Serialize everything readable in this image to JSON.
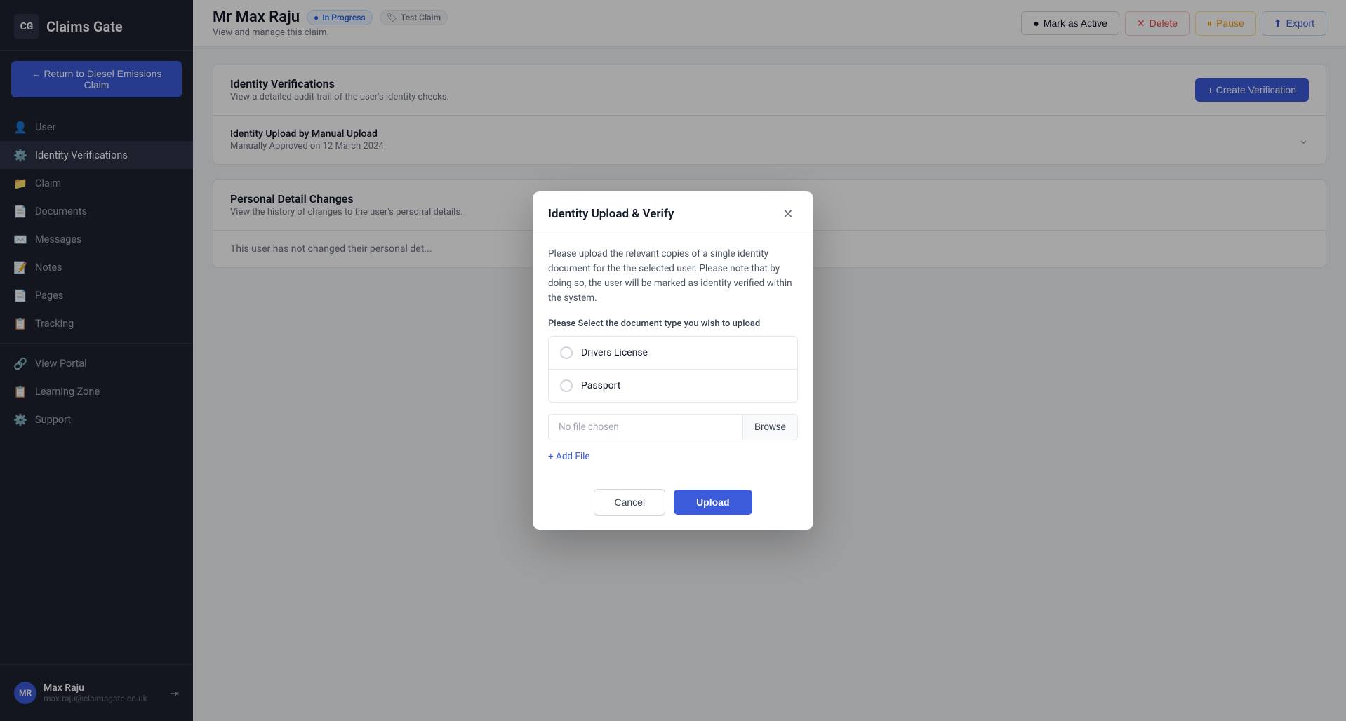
{
  "app": {
    "logo_initials": "CG",
    "logo_text": "Claims Gate"
  },
  "sidebar": {
    "return_button": "← Return to Diesel Emissions Claim",
    "nav_items": [
      {
        "id": "user",
        "label": "User",
        "icon": "👤",
        "active": false
      },
      {
        "id": "identity-verifications",
        "label": "Identity Verifications",
        "icon": "⚙️",
        "active": true
      },
      {
        "id": "claim",
        "label": "Claim",
        "icon": "📁",
        "active": false
      },
      {
        "id": "documents",
        "label": "Documents",
        "icon": "📄",
        "active": false
      },
      {
        "id": "messages",
        "label": "Messages",
        "icon": "✉️",
        "active": false
      },
      {
        "id": "notes",
        "label": "Notes",
        "icon": "📝",
        "active": false
      },
      {
        "id": "pages",
        "label": "Pages",
        "icon": "📄",
        "active": false
      },
      {
        "id": "tracking",
        "label": "Tracking",
        "icon": "📋",
        "active": false
      }
    ],
    "bottom_items": [
      {
        "id": "view-portal",
        "label": "View Portal",
        "icon": "🔗"
      },
      {
        "id": "learning-zone",
        "label": "Learning Zone",
        "icon": "📋"
      },
      {
        "id": "support",
        "label": "Support",
        "icon": "⚙️"
      }
    ],
    "user": {
      "name": "Max Raju",
      "email": "max.raju@claimsgate.co.uk",
      "initials": "MR"
    }
  },
  "header": {
    "user_name": "Mr Max Raju",
    "badge_progress": "In Progress",
    "badge_test": "Test Claim",
    "subtitle": "View and manage this claim.",
    "actions": {
      "mark_active": "Mark as Active",
      "delete": "Delete",
      "pause": "Pause",
      "export": "Export"
    }
  },
  "identity_section": {
    "title": "Identity Verifications",
    "subtitle": "View a detailed audit trail of the user's identity checks.",
    "create_button": "+ Create Verification",
    "item_title": "Identity Upload by Manual Upload",
    "item_subtitle": "Manually Approved on 12 March 2024"
  },
  "personal_section": {
    "title": "Personal Detail Changes",
    "subtitle": "View the history of changes to the user's personal details.",
    "empty_text": "This user has not changed their personal det..."
  },
  "modal": {
    "title": "Identity Upload & Verify",
    "description": "Please upload the relevant copies of a single identity document for the the selected user. Please note that by doing so, the user will be marked as identity verified within the system.",
    "select_label": "Please Select the document type you wish to upload",
    "document_options": [
      {
        "id": "drivers-license",
        "label": "Drivers License"
      },
      {
        "id": "passport",
        "label": "Passport"
      }
    ],
    "file_placeholder": "No file chosen",
    "browse_label": "Browse",
    "add_file_label": "+ Add File",
    "cancel_label": "Cancel",
    "upload_label": "Upload"
  }
}
